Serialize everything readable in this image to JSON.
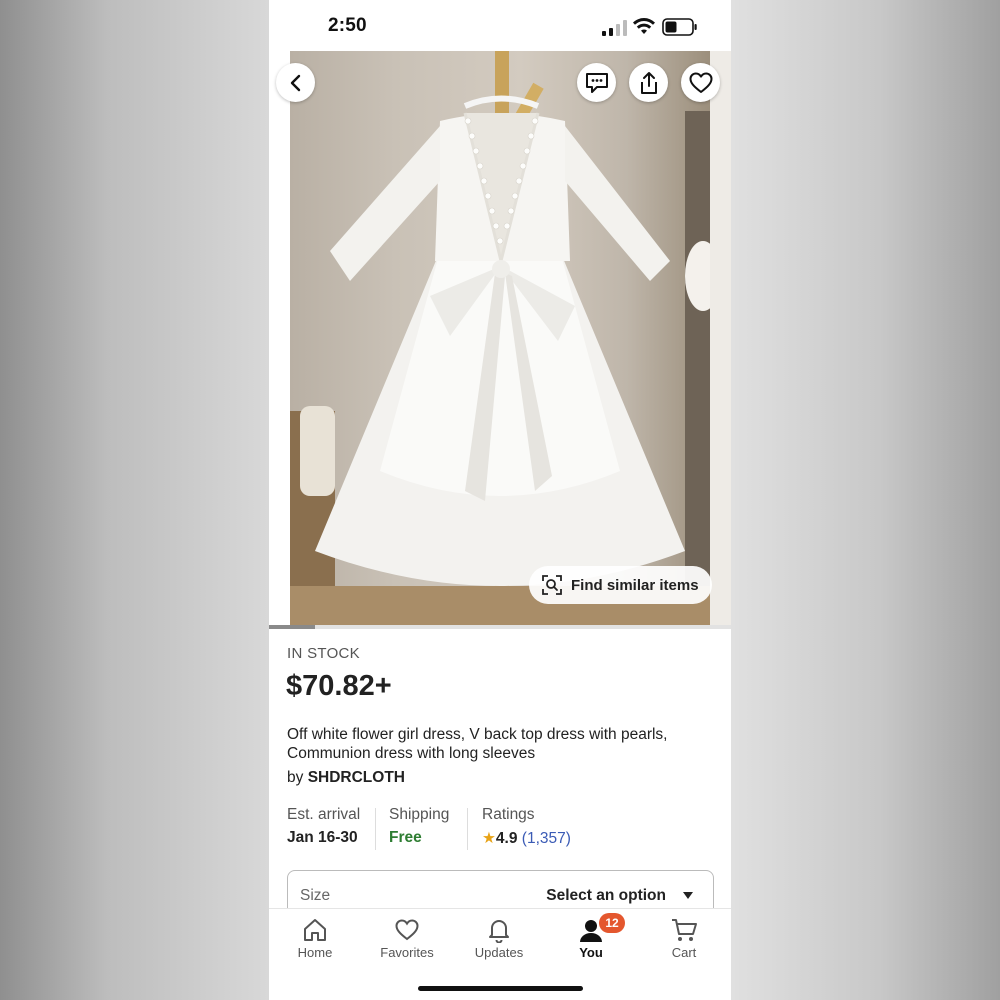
{
  "status_bar": {
    "time": "2:50"
  },
  "image_actions": {
    "back": "back-icon",
    "message": "message-icon",
    "share": "share-icon",
    "favorite": "heart-icon"
  },
  "find_similar": {
    "label": "Find similar items"
  },
  "product": {
    "stock": "IN STOCK",
    "price": "$70.82+",
    "title": "Off white flower girl dress, V back top dress with pearls, Communion dress with long sleeves",
    "by_prefix": "by",
    "shop": "SHDRCLOTH"
  },
  "info": {
    "arrival_label": "Est. arrival",
    "arrival_value": "Jan 16-30",
    "shipping_label": "Shipping",
    "shipping_value": "Free",
    "ratings_label": "Ratings",
    "rating_value": "4.9",
    "rating_count": "(1,357)"
  },
  "size_select": {
    "label": "Size",
    "value": "Select an option"
  },
  "tab_bar": {
    "items": [
      {
        "label": "Home"
      },
      {
        "label": "Favorites"
      },
      {
        "label": "Updates"
      },
      {
        "label": "You",
        "badge": "12"
      },
      {
        "label": "Cart"
      }
    ]
  },
  "colors": {
    "accent_green": "#2e7d32",
    "link_blue": "#3b5bb5",
    "badge": "#e4572e",
    "star": "#e8a317"
  }
}
